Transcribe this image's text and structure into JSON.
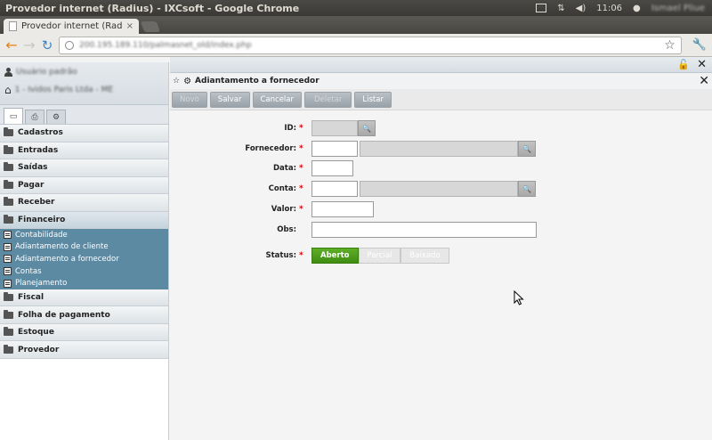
{
  "os": {
    "window_title": "Provedor internet (Radius) - IXCsoft - Google Chrome",
    "clock": "11:06",
    "user": "Ismael Pliue"
  },
  "browser": {
    "tab_title": "Provedor internet (Radius",
    "tab_close": "×",
    "url": "200.195.189.110/palmasnet_old/index.php"
  },
  "sidebar": {
    "user_label": "Usuário padrão",
    "company_label": "1 - Ividos Paris Ltda - ME",
    "menu": [
      {
        "label": "Cadastros"
      },
      {
        "label": "Entradas"
      },
      {
        "label": "Saídas"
      },
      {
        "label": "Pagar"
      },
      {
        "label": "Receber"
      },
      {
        "label": "Financeiro"
      }
    ],
    "submenu": [
      {
        "label": "Contabilidade"
      },
      {
        "label": "Adiantamento de cliente"
      },
      {
        "label": "Adiantamento a fornecedor"
      },
      {
        "label": "Contas"
      },
      {
        "label": "Planejamento"
      }
    ],
    "menu_after": [
      {
        "label": "Fiscal"
      },
      {
        "label": "Folha de pagamento"
      },
      {
        "label": "Estoque"
      },
      {
        "label": "Provedor"
      }
    ]
  },
  "panel": {
    "title": "Adiantamento a fornecedor",
    "buttons": {
      "novo": "Novo",
      "salvar": "Salvar",
      "cancelar": "Cancelar",
      "deletar": "Deletar",
      "listar": "Listar"
    }
  },
  "form": {
    "id_label": "ID:",
    "fornecedor_label": "Fornecedor:",
    "data_label": "Data:",
    "conta_label": "Conta:",
    "valor_label": "Valor:",
    "obs_label": "Obs:",
    "status_label": "Status:",
    "required_mark": "*",
    "status_options": [
      "Aberto",
      "Parcial",
      "Baixado"
    ],
    "status_selected": "Aberto"
  }
}
